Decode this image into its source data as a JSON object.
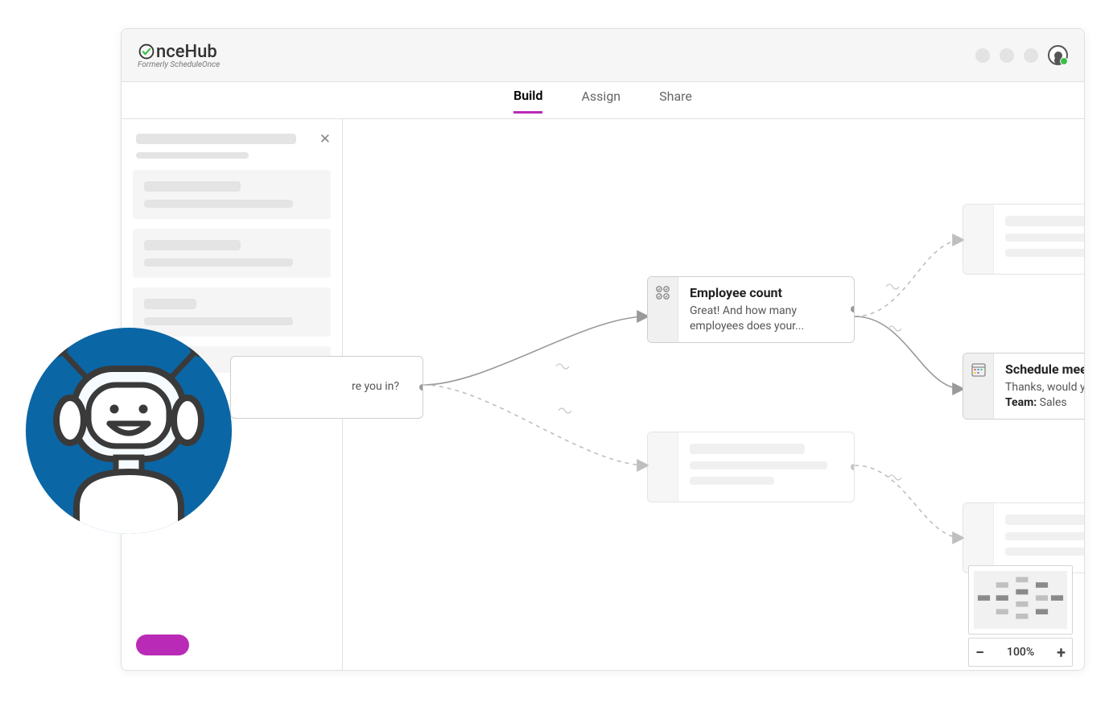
{
  "brand": {
    "name": "nceHub",
    "subtitle": "Formerly ScheduleOnce"
  },
  "tabs": {
    "build": "Build",
    "assign": "Assign",
    "share": "Share",
    "active": "build"
  },
  "sidebar": {
    "close_glyph": "✕"
  },
  "nodes": {
    "industry": {
      "title_fragment": "",
      "subtitle_fragment": "re you in?"
    },
    "employee_count": {
      "title": "Employee count",
      "subtitle": "Great! And how many employees does your..."
    },
    "schedule_meeting": {
      "title": "Schedule meeting",
      "subtitle_line": "Thanks, would you like...",
      "team_label": "Team:",
      "team_value": " Sales"
    }
  },
  "zoom": {
    "level": "100%",
    "minus": "−",
    "plus": "+"
  }
}
